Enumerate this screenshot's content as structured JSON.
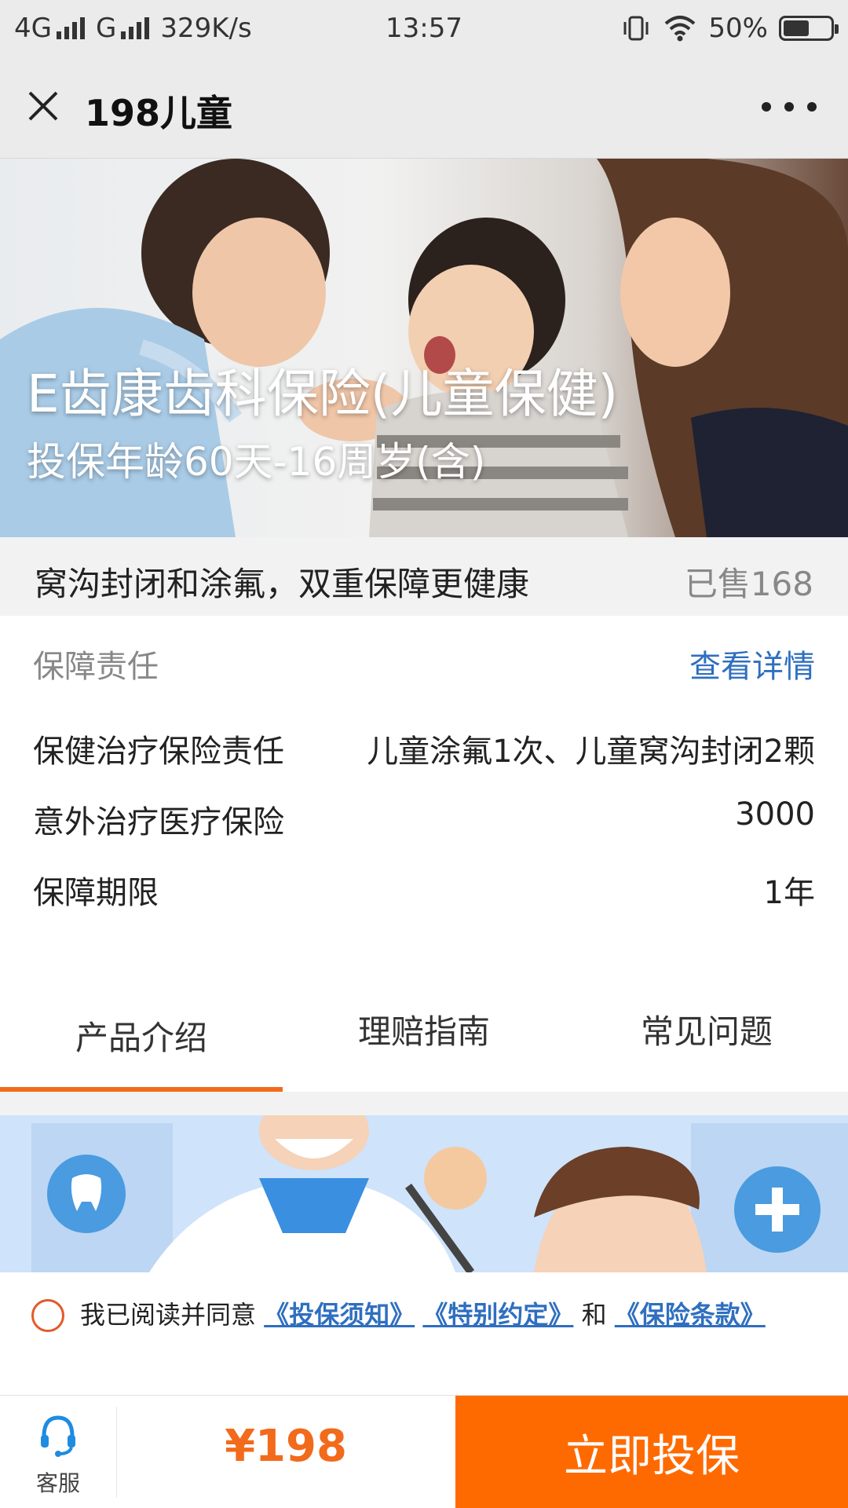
{
  "status_bar": {
    "network1": "4G",
    "network2": "G",
    "speed": "329K/s",
    "time": "13:57",
    "battery_percent": "50%",
    "battery_level": 0.5,
    "icons": [
      "signal-icon",
      "vibrate-icon",
      "wifi-icon",
      "battery-icon"
    ]
  },
  "header": {
    "title": "198儿童",
    "close_icon": "close-icon",
    "more_icon": "more-icon"
  },
  "hero": {
    "title": "E齿康齿科保险(儿童保健)",
    "subtitle": "投保年龄60天-16周岁(含)"
  },
  "slogan": {
    "text": "窝沟封闭和涂氟，双重保障更健康",
    "sold": "已售168"
  },
  "coverage": {
    "heading": "保障责任",
    "detail_link": "查看详情",
    "rows": [
      {
        "label": "保健治疗保险责任",
        "value": "儿童涂氟1次、儿童窝沟封闭2颗"
      },
      {
        "label": "意外治疗医疗保险",
        "value": "3000"
      },
      {
        "label": "保障期限",
        "value": "1年"
      }
    ]
  },
  "tabs": [
    {
      "label": "产品介绍",
      "active": true
    },
    {
      "label": "理赔指南",
      "active": false
    },
    {
      "label": "常见问题",
      "active": false
    }
  ],
  "agreement": {
    "prefix": "我已阅读并同意",
    "link1": "《投保须知》",
    "link2": "《特别约定》",
    "conj": "和",
    "link3": "《保险条款》"
  },
  "bottom_bar": {
    "service_label": "客服",
    "price": "¥198",
    "buy_label": "立即投保"
  },
  "colors": {
    "accent": "#ff6a00",
    "link": "#2f6fbf",
    "titlebar_bg": "#ebebeb"
  }
}
